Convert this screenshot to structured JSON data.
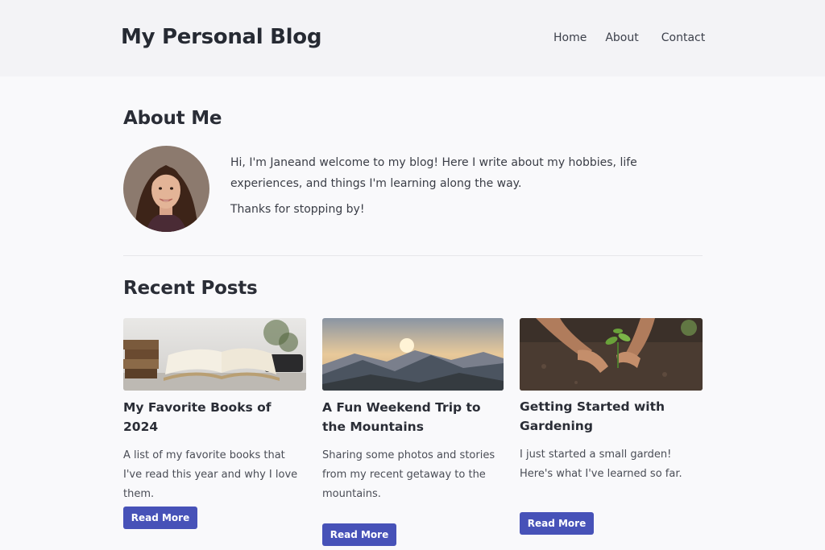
{
  "header": {
    "site_title": "My Personal Blog",
    "nav": [
      "Home",
      "About",
      "Contact"
    ]
  },
  "about": {
    "title": "About Me",
    "paragraph1": "Hi, I'm Janeand welcome to my blog! Here I write about my hobbies, life experiences, and things I'm learning along the way.",
    "paragraph2": "Thanks for stopping by!"
  },
  "posts": {
    "title": "Recent Posts",
    "items": [
      {
        "title": "My Favorite Books of 2024",
        "excerpt": "A list of my favorite books that I've read this year and why I love them.",
        "button": "Read More"
      },
      {
        "title": "A Fun Weekend Trip to the Mountains",
        "excerpt": "Sharing some photos and stories from my recent getaway to the mountains.",
        "button": "Read More"
      },
      {
        "title": "Getting Started with Gardening",
        "excerpt": "I just started a small garden! Here's what I've learned so far.",
        "button": "Read More"
      }
    ]
  },
  "colors": {
    "accent": "#4752b8",
    "background": "#f9f9fb",
    "header_bg": "#f3f3f6"
  }
}
